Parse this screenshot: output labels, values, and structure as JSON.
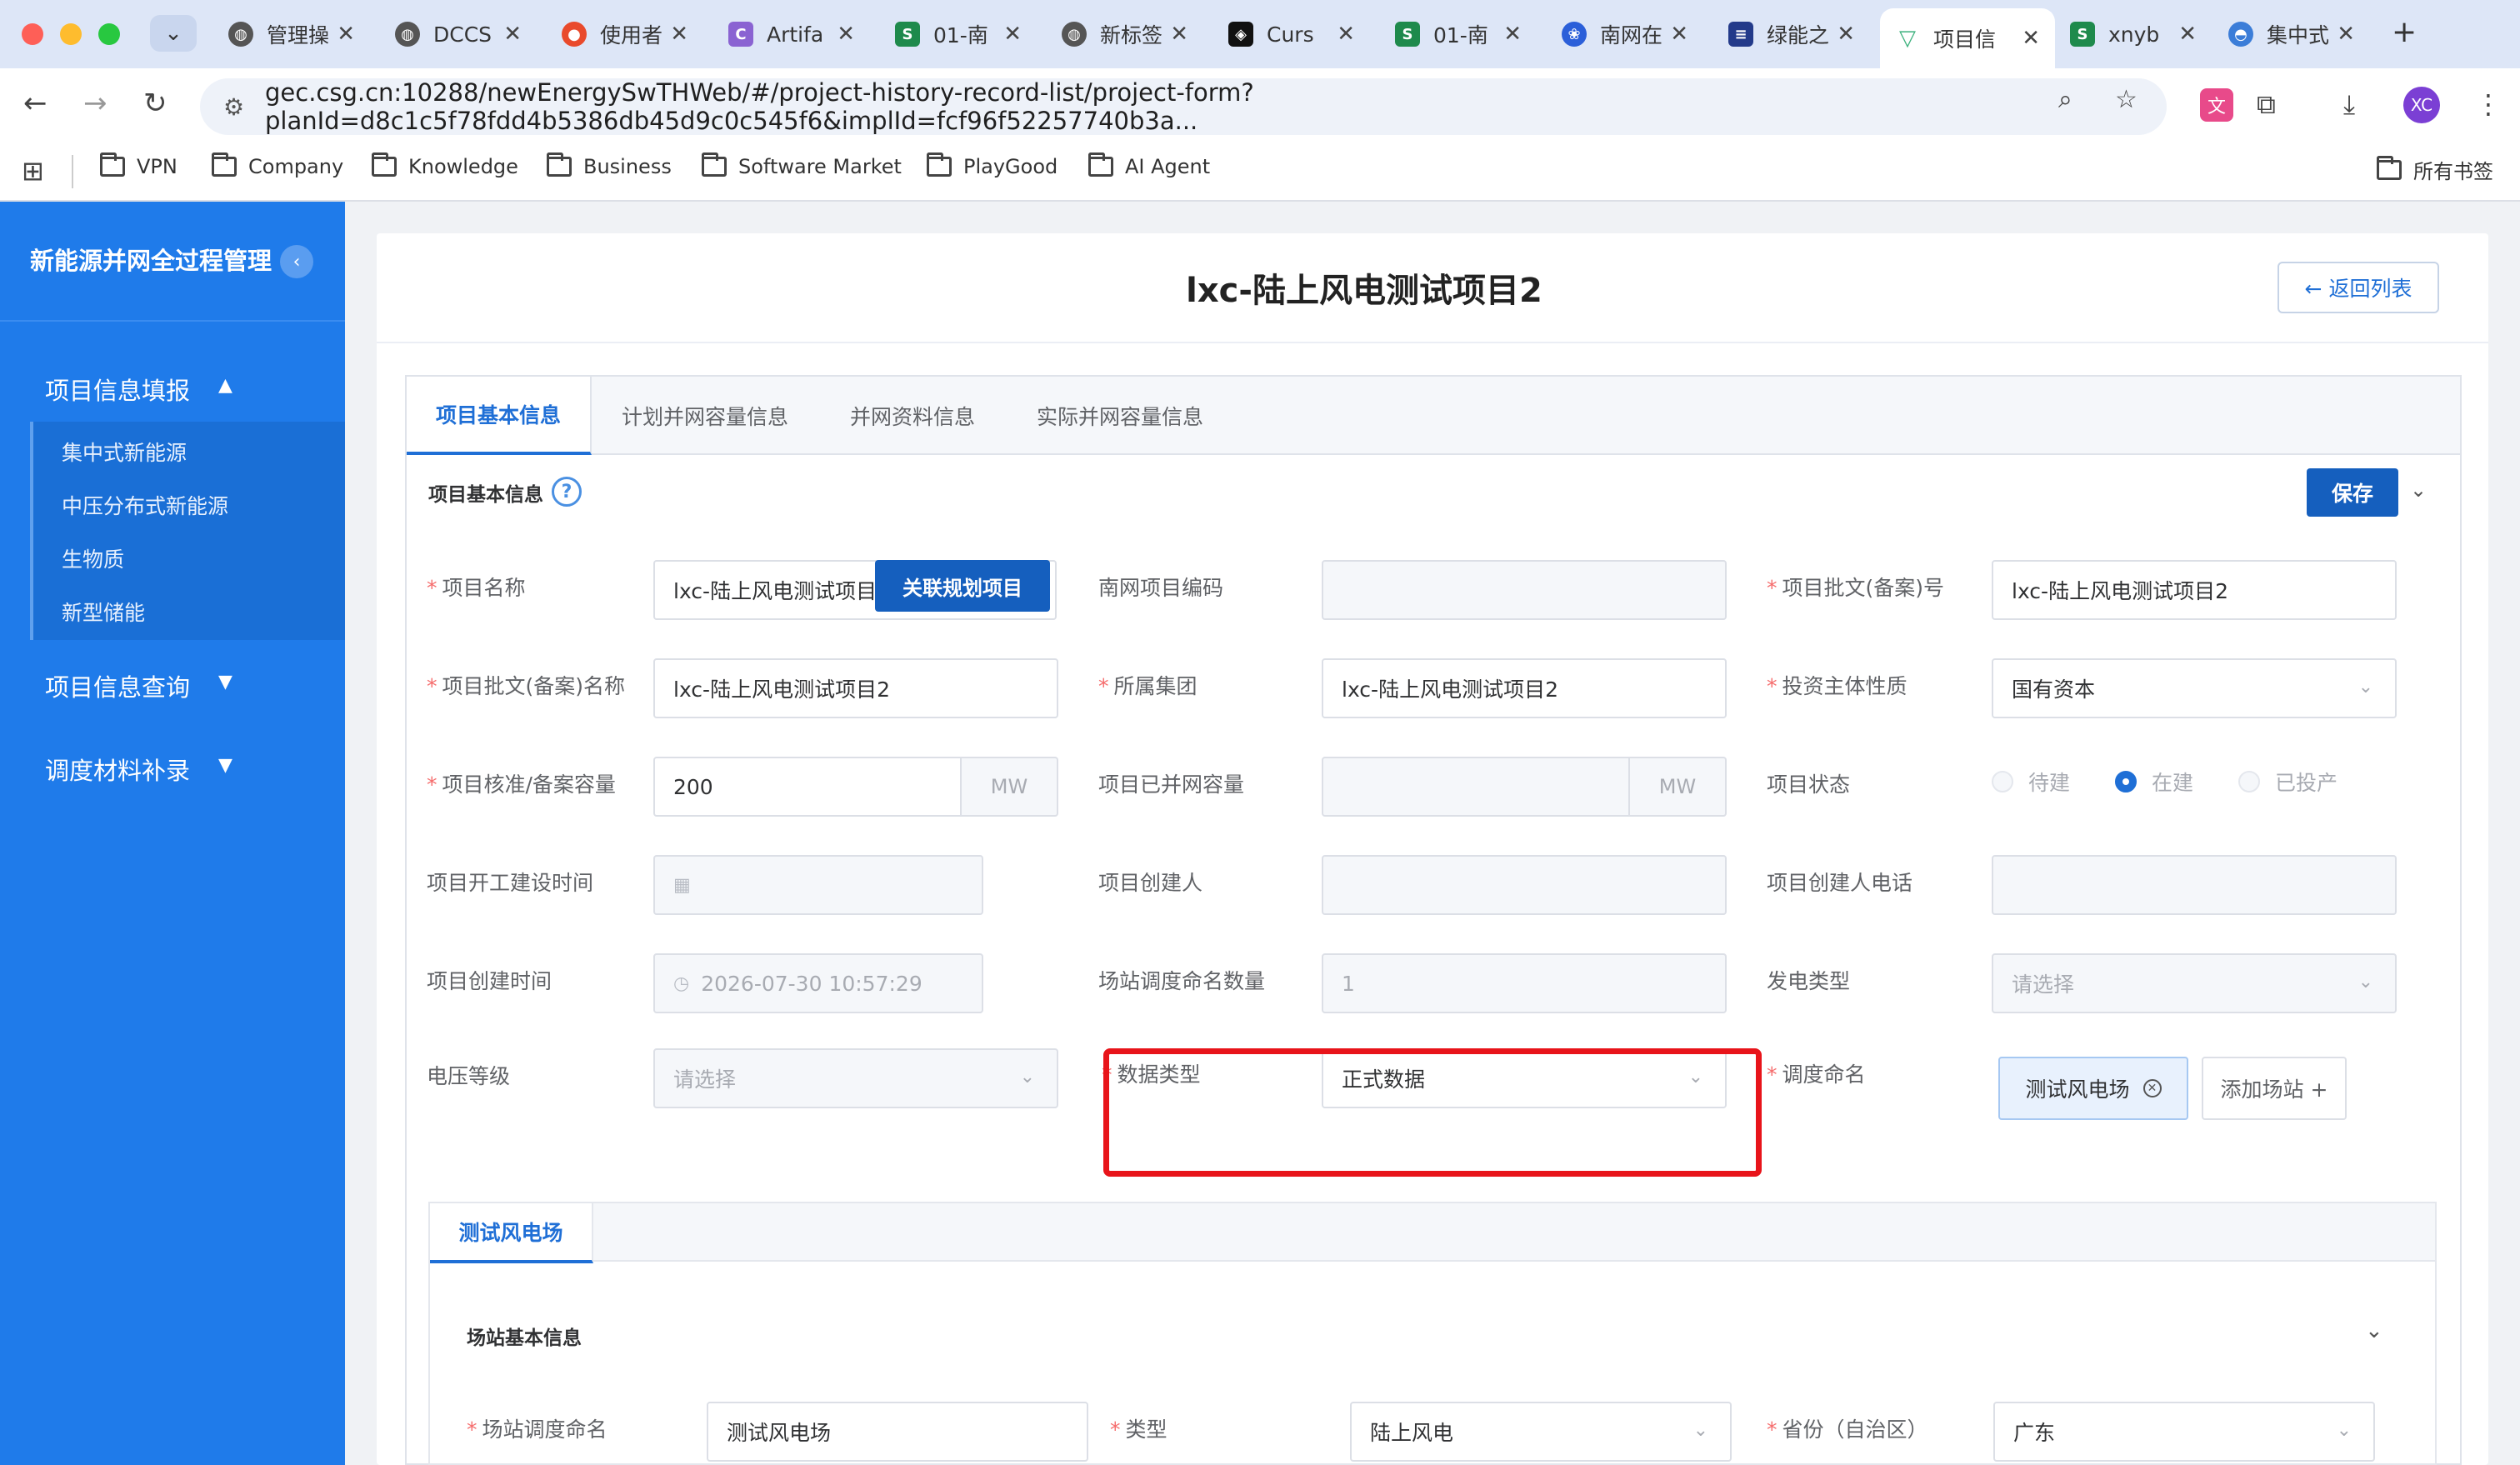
{
  "browser": {
    "tabs": [
      {
        "label": "管理操",
        "icon": "globe-icon"
      },
      {
        "label": "DCCS",
        "icon": "globe-icon"
      },
      {
        "label": "使用者",
        "icon": "chrome-icon"
      },
      {
        "label": "Artifa",
        "icon": "c-logo-icon"
      },
      {
        "label": "01-南",
        "icon": "sheet-icon"
      },
      {
        "label": "新标签",
        "icon": "globe-icon"
      },
      {
        "label": "Curs",
        "icon": "cursor-icon"
      },
      {
        "label": "01-南",
        "icon": "sheet-icon"
      },
      {
        "label": "南网在",
        "icon": "baidu-icon"
      },
      {
        "label": "绿能之",
        "icon": "doc-icon"
      },
      {
        "label": "项目信",
        "icon": "vue-icon",
        "active": true
      },
      {
        "label": "xnyb",
        "icon": "sheet-icon"
      },
      {
        "label": "集中式",
        "icon": "paw-icon"
      }
    ],
    "url": "gec.csg.cn:10288/newEnergySwTHWeb/#/project-history-record-list/project-form?planId=d8c1c5f78fdd4b5386db45d9c0c545f6&implId=fcf96f52257740b3a...",
    "avatar": "XC",
    "bookmarks": [
      "VPN",
      "Company",
      "Knowledge",
      "Business",
      "Software Market",
      "PlayGood",
      "AI Agent"
    ],
    "all_bookmarks": "所有书签"
  },
  "sidebar": {
    "title": "新能源并网全过程管理",
    "groups": [
      {
        "label": "项目信息填报",
        "expanded": true
      },
      {
        "label": "项目信息查询",
        "expanded": false
      },
      {
        "label": "调度材料补录",
        "expanded": false
      }
    ],
    "items": [
      "集中式新能源",
      "中压分布式新能源",
      "生物质",
      "新型储能"
    ]
  },
  "page": {
    "title": "lxc-陆上风电测试项目2",
    "back_label": "← 返回列表",
    "tabs": [
      "项目基本信息",
      "计划并网容量信息",
      "并网资料信息",
      "实际并网容量信息"
    ],
    "section_title": "项目基本信息",
    "save_label": "保存"
  },
  "form": {
    "project_name": {
      "label": "项目名称",
      "value": "lxc-陆上风电测试项目2"
    },
    "link_btn": "关联规划项目",
    "csg_code": {
      "label": "南网项目编码",
      "value": ""
    },
    "approval_no": {
      "label": "项目批文(备案)号",
      "value": "lxc-陆上风电测试项目2"
    },
    "approval_name": {
      "label": "项目批文(备案)名称",
      "value": "lxc-陆上风电测试项目2"
    },
    "group": {
      "label": "所属集团",
      "value": "lxc-陆上风电测试项目2"
    },
    "investor_type": {
      "label": "投资主体性质",
      "value": "国有资本"
    },
    "capacity": {
      "label": "项目核准/备案容量",
      "value": "200",
      "unit": "MW"
    },
    "connected_capacity": {
      "label": "项目已并网容量",
      "value": "",
      "unit": "MW"
    },
    "status": {
      "label": "项目状态",
      "options": [
        "待建",
        "在建",
        "已投产"
      ],
      "selected": "在建"
    },
    "start_time": {
      "label": "项目开工建设时间",
      "value": ""
    },
    "creator": {
      "label": "项目创建人",
      "value": ""
    },
    "creator_phone": {
      "label": "项目创建人电话",
      "value": ""
    },
    "create_time": {
      "label": "项目创建时间",
      "value": "2026-07-30 10:57:29"
    },
    "station_count": {
      "label": "场站调度命名数量",
      "value": "1"
    },
    "gen_type": {
      "label": "发电类型",
      "placeholder": "请选择"
    },
    "voltage": {
      "label": "电压等级",
      "placeholder": "请选择"
    },
    "data_type": {
      "label": "数据类型",
      "value": "正式数据"
    },
    "dispatch_name": {
      "label": "调度命名",
      "tag": "测试风电场",
      "add_label": "添加场站 +"
    }
  },
  "station": {
    "tab": "测试风电场",
    "section_title": "场站基本信息",
    "dispatch_name": {
      "label": "场站调度命名",
      "value": "测试风电场"
    },
    "type": {
      "label": "类型",
      "value": "陆上风电"
    },
    "province": {
      "label": "省份（自治区）",
      "value": "广东"
    }
  },
  "colors": {
    "sidebar": "#1f7bea",
    "primary_button": "#155fbe",
    "highlight_box": "#e8141a",
    "required": "#f56c6c"
  }
}
